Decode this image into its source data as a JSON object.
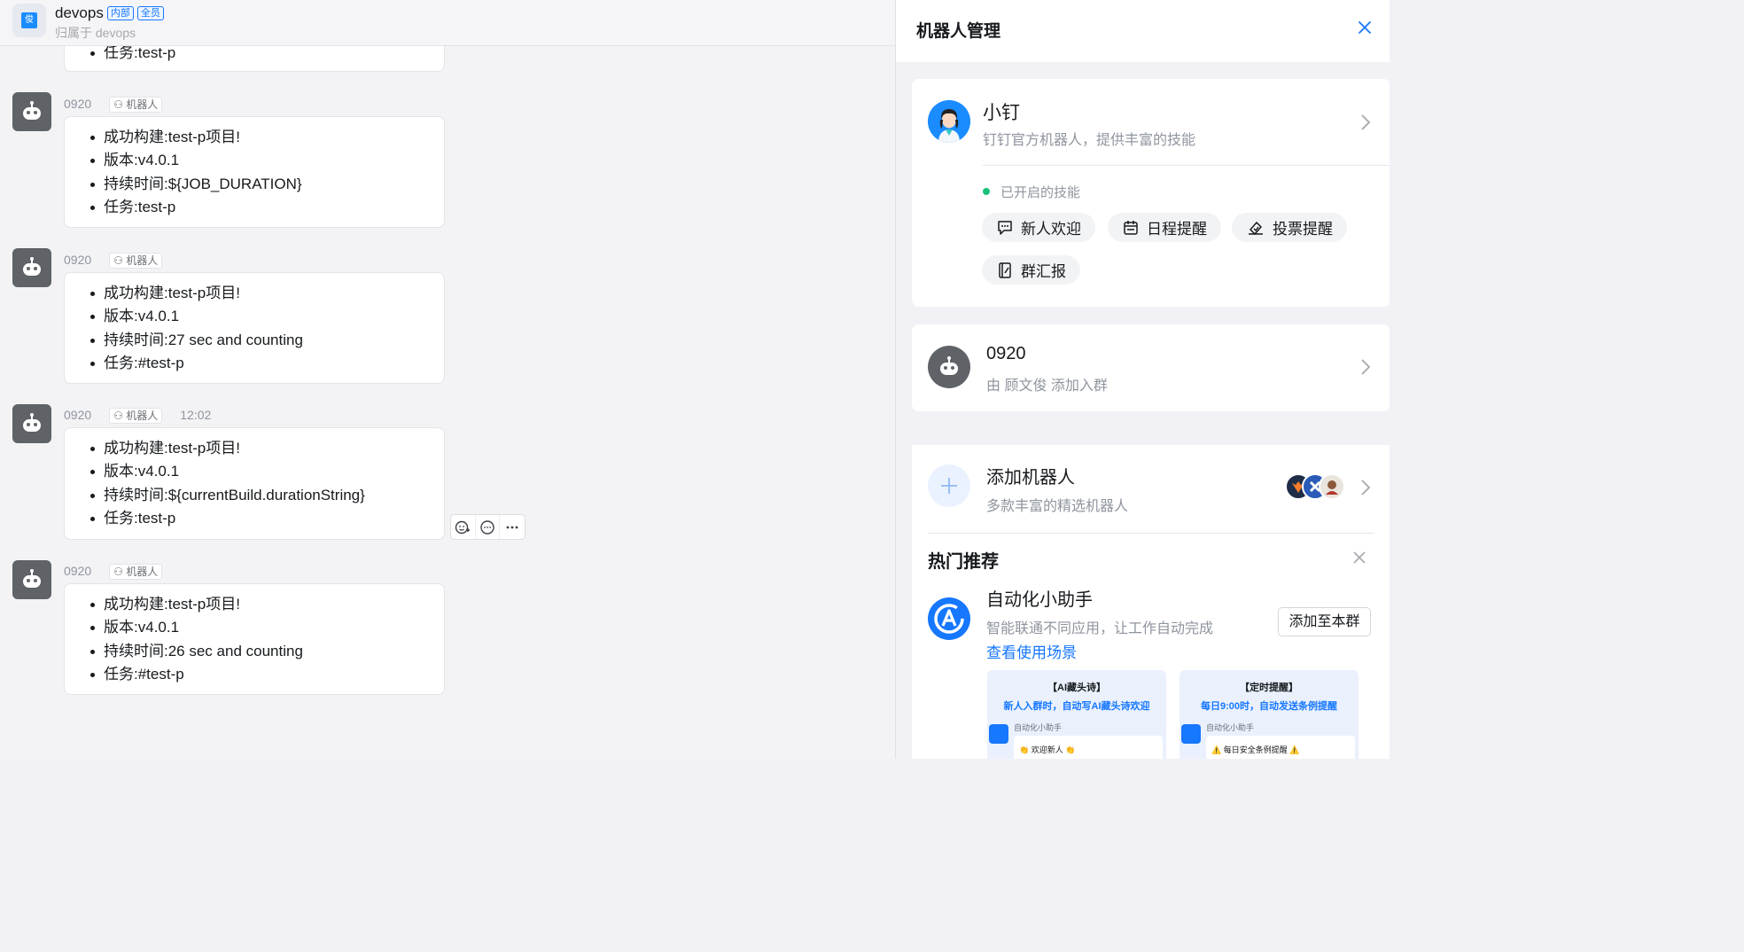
{
  "chat": {
    "group_name": "devops",
    "tags": [
      "内部",
      "全员"
    ],
    "group_sub": "归属于 devops",
    "group_avatar_char": "俊",
    "partial_message": {
      "line": "任务:test-p"
    },
    "messages": [
      {
        "sender": "0920",
        "badge": "机器人",
        "time": "",
        "lines": [
          "成功构建:test-p项目!",
          "版本:v4.0.1",
          "持续时间:${JOB_DURATION}",
          "任务:test-p"
        ]
      },
      {
        "sender": "0920",
        "badge": "机器人",
        "time": "",
        "lines": [
          "成功构建:test-p项目!",
          "版本:v4.0.1",
          "持续时间:27 sec and counting",
          "任务:#test-p"
        ]
      },
      {
        "sender": "0920",
        "badge": "机器人",
        "time": "12:02",
        "lines": [
          "成功构建:test-p项目!",
          "版本:v4.0.1",
          "持续时间:${currentBuild.durationString}",
          "任务:test-p"
        ]
      },
      {
        "sender": "0920",
        "badge": "机器人",
        "time": "",
        "lines": [
          "成功构建:test-p项目!",
          "版本:v4.0.1",
          "持续时间:26 sec and counting",
          "任务:#test-p"
        ]
      }
    ]
  },
  "panel": {
    "title": "机器人管理",
    "xiaoding": {
      "name": "小钉",
      "desc": "钉钉官方机器人，提供丰富的技能",
      "skills_label": "已开启的技能",
      "skills": [
        "新人欢迎",
        "日程提醒",
        "投票提醒",
        "群汇报"
      ]
    },
    "bot_0920": {
      "name": "0920",
      "desc": "由 顾文俊 添加入群"
    },
    "add_robot": {
      "title": "添加机器人",
      "desc": "多款丰富的精选机器人"
    },
    "hot": {
      "title": "热门推荐",
      "item_name": "自动化小助手",
      "item_desc": "智能联通不同应用，让工作自动完成",
      "item_link": "查看使用场景",
      "item_button": "添加至本群",
      "promos": [
        {
          "title": "【AI藏头诗】",
          "subtitle": "新人入群时，自动写AI藏头诗欢迎",
          "bot": "自动化小助手",
          "message": "👏 欢迎新人 👏"
        },
        {
          "title": "【定时提醒】",
          "subtitle": "每日9:00时，自动发送条例提醒",
          "bot": "自动化小助手",
          "message": "⚠️ 每日安全条例提醒 ⚠️"
        }
      ]
    }
  },
  "colors": {
    "accent": "#1677ff",
    "status_green": "#1bc17b",
    "bot_avatar": "#5f6368"
  }
}
